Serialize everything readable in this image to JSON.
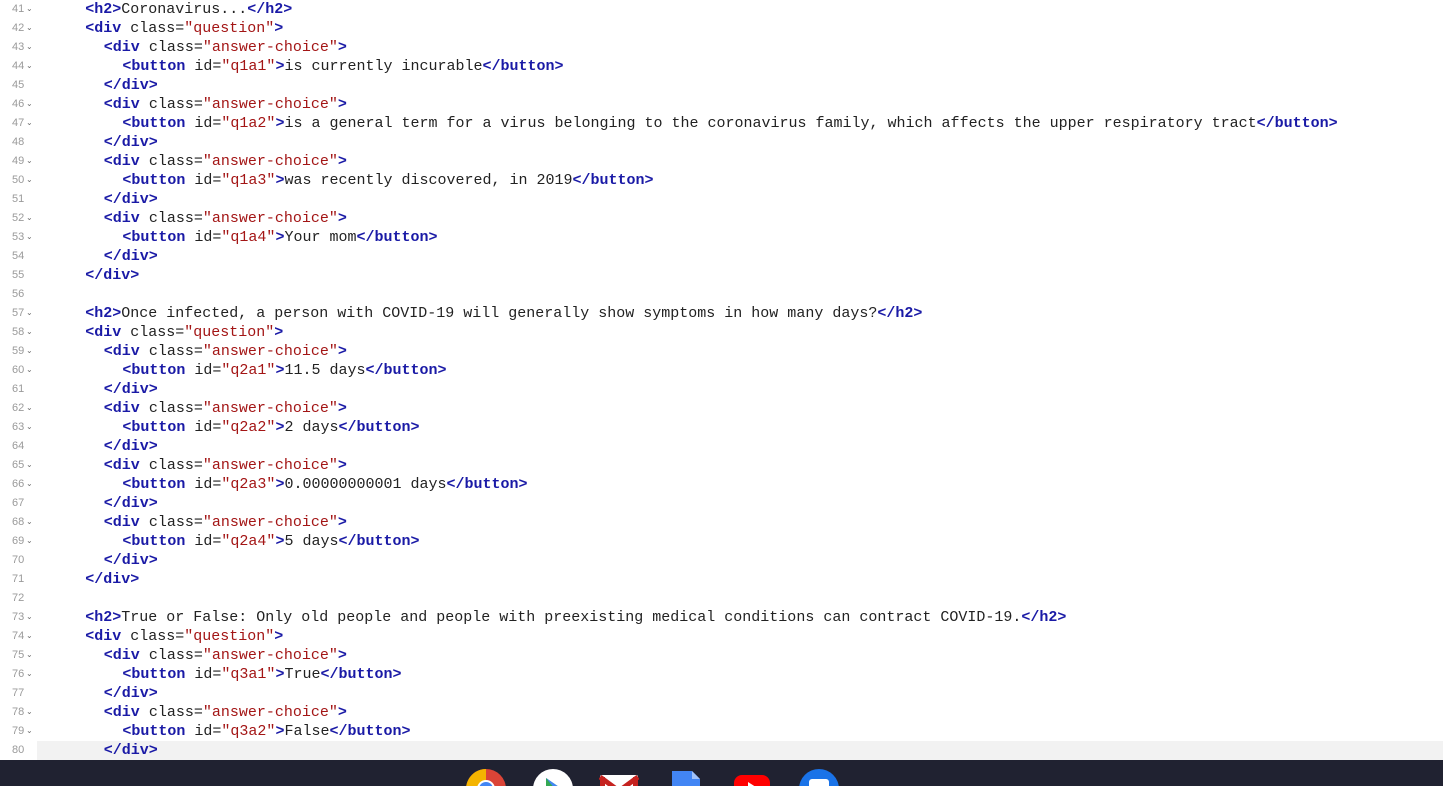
{
  "editor": {
    "lines": [
      {
        "num": "41",
        "fold": true,
        "indent": 2,
        "tokens": [
          {
            "c": "tag",
            "t": "<h2>"
          },
          {
            "c": "txt",
            "t": "Coronavirus..."
          },
          {
            "c": "tag",
            "t": "</h2>"
          }
        ]
      },
      {
        "num": "42",
        "fold": true,
        "indent": 2,
        "tokens": [
          {
            "c": "tag",
            "t": "<div"
          },
          {
            "c": "attr",
            "t": " class="
          },
          {
            "c": "str",
            "t": "\"question\""
          },
          {
            "c": "tag",
            "t": ">"
          }
        ]
      },
      {
        "num": "43",
        "fold": true,
        "indent": 3,
        "tokens": [
          {
            "c": "tag",
            "t": "<div"
          },
          {
            "c": "attr",
            "t": " class="
          },
          {
            "c": "str",
            "t": "\"answer-choice\""
          },
          {
            "c": "tag",
            "t": ">"
          }
        ]
      },
      {
        "num": "44",
        "fold": true,
        "indent": 4,
        "tokens": [
          {
            "c": "tag",
            "t": "<button"
          },
          {
            "c": "attr",
            "t": " id="
          },
          {
            "c": "str",
            "t": "\"q1a1\""
          },
          {
            "c": "tag",
            "t": ">"
          },
          {
            "c": "txt",
            "t": "is currently incurable"
          },
          {
            "c": "tag",
            "t": "</button>"
          }
        ]
      },
      {
        "num": "45",
        "fold": false,
        "indent": 3,
        "tokens": [
          {
            "c": "tag",
            "t": "</div>"
          }
        ]
      },
      {
        "num": "46",
        "fold": true,
        "indent": 3,
        "tokens": [
          {
            "c": "tag",
            "t": "<div"
          },
          {
            "c": "attr",
            "t": " class="
          },
          {
            "c": "str",
            "t": "\"answer-choice\""
          },
          {
            "c": "tag",
            "t": ">"
          }
        ]
      },
      {
        "num": "47",
        "fold": true,
        "indent": 4,
        "tokens": [
          {
            "c": "tag",
            "t": "<button"
          },
          {
            "c": "attr",
            "t": " id="
          },
          {
            "c": "str",
            "t": "\"q1a2\""
          },
          {
            "c": "tag",
            "t": ">"
          },
          {
            "c": "txt",
            "t": "is a general term for a virus belonging to the coronavirus family, which affects the upper respiratory tract"
          },
          {
            "c": "tag",
            "t": "</button>"
          }
        ]
      },
      {
        "num": "48",
        "fold": false,
        "indent": 3,
        "tokens": [
          {
            "c": "tag",
            "t": "</div>"
          }
        ]
      },
      {
        "num": "49",
        "fold": true,
        "indent": 3,
        "tokens": [
          {
            "c": "tag",
            "t": "<div"
          },
          {
            "c": "attr",
            "t": " class="
          },
          {
            "c": "str",
            "t": "\"answer-choice\""
          },
          {
            "c": "tag",
            "t": ">"
          }
        ]
      },
      {
        "num": "50",
        "fold": true,
        "indent": 4,
        "tokens": [
          {
            "c": "tag",
            "t": "<button"
          },
          {
            "c": "attr",
            "t": " id="
          },
          {
            "c": "str",
            "t": "\"q1a3\""
          },
          {
            "c": "tag",
            "t": ">"
          },
          {
            "c": "txt",
            "t": "was recently discovered, in 2019"
          },
          {
            "c": "tag",
            "t": "</button>"
          }
        ]
      },
      {
        "num": "51",
        "fold": false,
        "indent": 3,
        "tokens": [
          {
            "c": "tag",
            "t": "</div>"
          }
        ]
      },
      {
        "num": "52",
        "fold": true,
        "indent": 3,
        "tokens": [
          {
            "c": "tag",
            "t": "<div"
          },
          {
            "c": "attr",
            "t": " class="
          },
          {
            "c": "str",
            "t": "\"answer-choice\""
          },
          {
            "c": "tag",
            "t": ">"
          }
        ]
      },
      {
        "num": "53",
        "fold": true,
        "indent": 4,
        "tokens": [
          {
            "c": "tag",
            "t": "<button"
          },
          {
            "c": "attr",
            "t": " id="
          },
          {
            "c": "str",
            "t": "\"q1a4\""
          },
          {
            "c": "tag",
            "t": ">"
          },
          {
            "c": "txt",
            "t": "Your mom"
          },
          {
            "c": "tag",
            "t": "</button>"
          }
        ]
      },
      {
        "num": "54",
        "fold": false,
        "indent": 3,
        "tokens": [
          {
            "c": "tag",
            "t": "</div>"
          }
        ]
      },
      {
        "num": "55",
        "fold": false,
        "indent": 2,
        "tokens": [
          {
            "c": "tag",
            "t": "</div>"
          }
        ]
      },
      {
        "num": "56",
        "fold": false,
        "indent": 0,
        "tokens": []
      },
      {
        "num": "57",
        "fold": true,
        "indent": 2,
        "tokens": [
          {
            "c": "tag",
            "t": "<h2>"
          },
          {
            "c": "txt",
            "t": "Once infected, a person with COVID-19 will generally show symptoms in how many days?"
          },
          {
            "c": "tag",
            "t": "</h2>"
          }
        ]
      },
      {
        "num": "58",
        "fold": true,
        "indent": 2,
        "tokens": [
          {
            "c": "tag",
            "t": "<div"
          },
          {
            "c": "attr",
            "t": " class="
          },
          {
            "c": "str",
            "t": "\"question\""
          },
          {
            "c": "tag",
            "t": ">"
          }
        ]
      },
      {
        "num": "59",
        "fold": true,
        "indent": 3,
        "tokens": [
          {
            "c": "tag",
            "t": "<div"
          },
          {
            "c": "attr",
            "t": " class="
          },
          {
            "c": "str",
            "t": "\"answer-choice\""
          },
          {
            "c": "tag",
            "t": ">"
          }
        ]
      },
      {
        "num": "60",
        "fold": true,
        "indent": 4,
        "tokens": [
          {
            "c": "tag",
            "t": "<button"
          },
          {
            "c": "attr",
            "t": " id="
          },
          {
            "c": "str",
            "t": "\"q2a1\""
          },
          {
            "c": "tag",
            "t": ">"
          },
          {
            "c": "txt",
            "t": "11.5 days"
          },
          {
            "c": "tag",
            "t": "</button>"
          }
        ]
      },
      {
        "num": "61",
        "fold": false,
        "indent": 3,
        "tokens": [
          {
            "c": "tag",
            "t": "</div>"
          }
        ]
      },
      {
        "num": "62",
        "fold": true,
        "indent": 3,
        "tokens": [
          {
            "c": "tag",
            "t": "<div"
          },
          {
            "c": "attr",
            "t": " class="
          },
          {
            "c": "str",
            "t": "\"answer-choice\""
          },
          {
            "c": "tag",
            "t": ">"
          }
        ]
      },
      {
        "num": "63",
        "fold": true,
        "indent": 4,
        "tokens": [
          {
            "c": "tag",
            "t": "<button"
          },
          {
            "c": "attr",
            "t": " id="
          },
          {
            "c": "str",
            "t": "\"q2a2\""
          },
          {
            "c": "tag",
            "t": ">"
          },
          {
            "c": "txt",
            "t": "2 days"
          },
          {
            "c": "tag",
            "t": "</button>"
          }
        ]
      },
      {
        "num": "64",
        "fold": false,
        "indent": 3,
        "tokens": [
          {
            "c": "tag",
            "t": "</div>"
          }
        ]
      },
      {
        "num": "65",
        "fold": true,
        "indent": 3,
        "tokens": [
          {
            "c": "tag",
            "t": "<div"
          },
          {
            "c": "attr",
            "t": " class="
          },
          {
            "c": "str",
            "t": "\"answer-choice\""
          },
          {
            "c": "tag",
            "t": ">"
          }
        ]
      },
      {
        "num": "66",
        "fold": true,
        "indent": 4,
        "tokens": [
          {
            "c": "tag",
            "t": "<button"
          },
          {
            "c": "attr",
            "t": " id="
          },
          {
            "c": "str",
            "t": "\"q2a3\""
          },
          {
            "c": "tag",
            "t": ">"
          },
          {
            "c": "txt",
            "t": "0.00000000001 days"
          },
          {
            "c": "tag",
            "t": "</button>"
          }
        ]
      },
      {
        "num": "67",
        "fold": false,
        "indent": 3,
        "tokens": [
          {
            "c": "tag",
            "t": "</div>"
          }
        ]
      },
      {
        "num": "68",
        "fold": true,
        "indent": 3,
        "tokens": [
          {
            "c": "tag",
            "t": "<div"
          },
          {
            "c": "attr",
            "t": " class="
          },
          {
            "c": "str",
            "t": "\"answer-choice\""
          },
          {
            "c": "tag",
            "t": ">"
          }
        ]
      },
      {
        "num": "69",
        "fold": true,
        "indent": 4,
        "tokens": [
          {
            "c": "tag",
            "t": "<button"
          },
          {
            "c": "attr",
            "t": " id="
          },
          {
            "c": "str",
            "t": "\"q2a4\""
          },
          {
            "c": "tag",
            "t": ">"
          },
          {
            "c": "txt",
            "t": "5 days"
          },
          {
            "c": "tag",
            "t": "</button>"
          }
        ]
      },
      {
        "num": "70",
        "fold": false,
        "indent": 3,
        "tokens": [
          {
            "c": "tag",
            "t": "</div>"
          }
        ]
      },
      {
        "num": "71",
        "fold": false,
        "indent": 2,
        "tokens": [
          {
            "c": "tag",
            "t": "</div>"
          }
        ]
      },
      {
        "num": "72",
        "fold": false,
        "indent": 0,
        "tokens": []
      },
      {
        "num": "73",
        "fold": true,
        "indent": 2,
        "tokens": [
          {
            "c": "tag",
            "t": "<h2>"
          },
          {
            "c": "txt",
            "t": "True or False: Only old people and people with preexisting medical conditions can contract COVID-19."
          },
          {
            "c": "tag",
            "t": "</h2>"
          }
        ]
      },
      {
        "num": "74",
        "fold": true,
        "indent": 2,
        "tokens": [
          {
            "c": "tag",
            "t": "<div"
          },
          {
            "c": "attr",
            "t": " class="
          },
          {
            "c": "str",
            "t": "\"question\""
          },
          {
            "c": "tag",
            "t": ">"
          }
        ]
      },
      {
        "num": "75",
        "fold": true,
        "indent": 3,
        "tokens": [
          {
            "c": "tag",
            "t": "<div"
          },
          {
            "c": "attr",
            "t": " class="
          },
          {
            "c": "str",
            "t": "\"answer-choice\""
          },
          {
            "c": "tag",
            "t": ">"
          }
        ]
      },
      {
        "num": "76",
        "fold": true,
        "indent": 4,
        "tokens": [
          {
            "c": "tag",
            "t": "<button"
          },
          {
            "c": "attr",
            "t": " id="
          },
          {
            "c": "str",
            "t": "\"q3a1\""
          },
          {
            "c": "tag",
            "t": ">"
          },
          {
            "c": "txt",
            "t": "True"
          },
          {
            "c": "tag",
            "t": "</button>"
          }
        ]
      },
      {
        "num": "77",
        "fold": false,
        "indent": 3,
        "tokens": [
          {
            "c": "tag",
            "t": "</div>"
          }
        ]
      },
      {
        "num": "78",
        "fold": true,
        "indent": 3,
        "tokens": [
          {
            "c": "tag",
            "t": "<div"
          },
          {
            "c": "attr",
            "t": " class="
          },
          {
            "c": "str",
            "t": "\"answer-choice\""
          },
          {
            "c": "tag",
            "t": ">"
          }
        ]
      },
      {
        "num": "79",
        "fold": true,
        "indent": 4,
        "tokens": [
          {
            "c": "tag",
            "t": "<button"
          },
          {
            "c": "attr",
            "t": " id="
          },
          {
            "c": "str",
            "t": "\"q3a2\""
          },
          {
            "c": "tag",
            "t": ">"
          },
          {
            "c": "txt",
            "t": "False"
          },
          {
            "c": "tag",
            "t": "</button>"
          }
        ]
      },
      {
        "num": "80",
        "fold": false,
        "indent": 3,
        "active": true,
        "tokens": [
          {
            "c": "tag",
            "t": "</div>"
          }
        ]
      }
    ]
  },
  "taskbar": {
    "apps": [
      {
        "name": "chrome-icon"
      },
      {
        "name": "play-store-icon"
      },
      {
        "name": "gmail-icon"
      },
      {
        "name": "docs-icon"
      },
      {
        "name": "youtube-icon"
      },
      {
        "name": "messages-icon"
      }
    ]
  }
}
